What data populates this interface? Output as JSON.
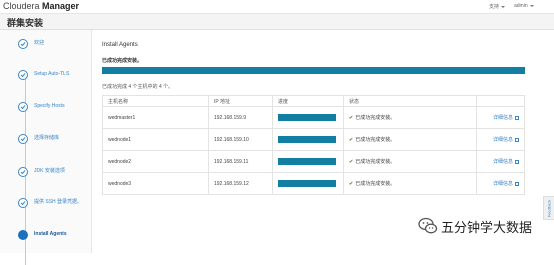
{
  "header": {
    "brand_prefix": "Cloudera",
    "brand_suffix": "Manager",
    "language_menu": "支持",
    "user_menu": "admin"
  },
  "page_title": "群集安装",
  "sidebar": {
    "steps": [
      {
        "label": "欢迎",
        "state": "done"
      },
      {
        "label": "Setup Auto-TLS",
        "state": "done"
      },
      {
        "label": "Specify Hosts",
        "state": "done"
      },
      {
        "label": "选择存储库",
        "state": "done"
      },
      {
        "label": "JDK 安装选项",
        "state": "done"
      },
      {
        "label": "提供 SSH 登录凭据。",
        "state": "done"
      },
      {
        "label": "Install Agents",
        "state": "active"
      }
    ]
  },
  "main": {
    "section_title": "Install Agents",
    "status_text": "已成功完成安装。",
    "overall_progress": 1.0,
    "summary": "已成功完成 4 个主机中的 4 个。",
    "table": {
      "headers": [
        "主机名称",
        "IP 地址",
        "进度",
        "状态",
        ""
      ],
      "rows": [
        {
          "host": "wedmaster1",
          "ip": "192.168.159.9",
          "progress": 1.0,
          "status": "已成功完成安装。",
          "details": "详细信息"
        },
        {
          "host": "wednode1",
          "ip": "192.168.159.10",
          "progress": 1.0,
          "status": "已成功完成安装。",
          "details": "详细信息"
        },
        {
          "host": "wednode2",
          "ip": "192.168.159.11",
          "progress": 1.0,
          "status": "已成功完成安装。",
          "details": "详细信息"
        },
        {
          "host": "wednode3",
          "ip": "192.168.159.12",
          "progress": 1.0,
          "status": "已成功完成安装。",
          "details": "详细信息"
        }
      ]
    }
  },
  "feedback_tab": "Feedback",
  "watermark": "五分钟学大数据",
  "colors": {
    "progress": "#127ea1",
    "link": "#3a84c9",
    "success": "#5a9e2f"
  }
}
